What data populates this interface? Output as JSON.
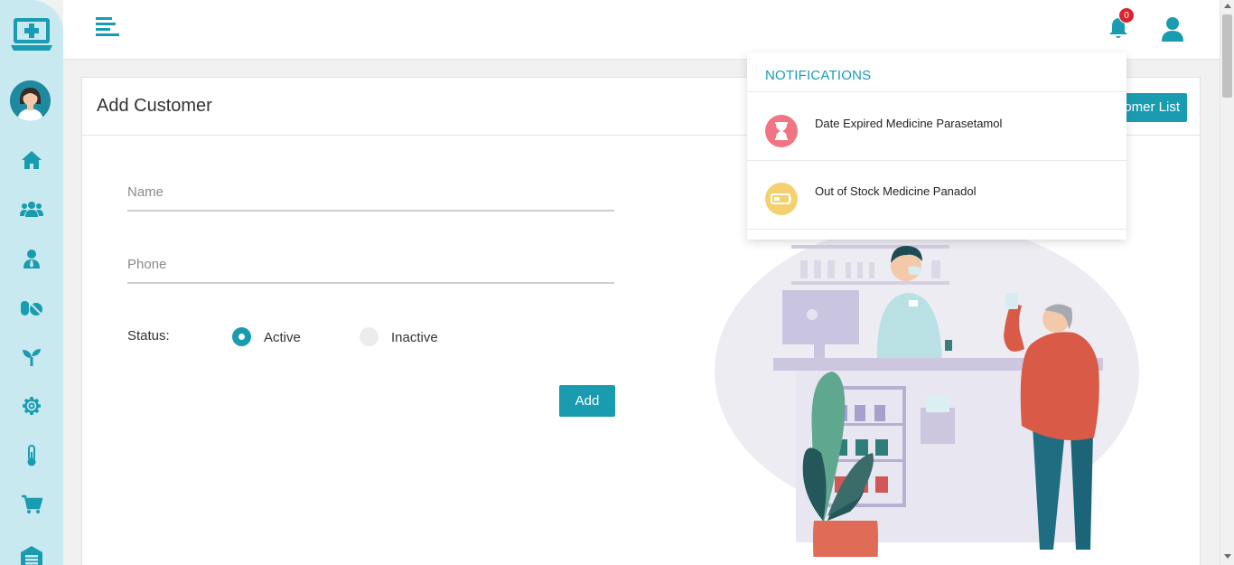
{
  "topbar": {
    "notification_count": "0"
  },
  "page": {
    "title": "Add Customer",
    "list_button_label": "omer List"
  },
  "form": {
    "name_placeholder": "Name",
    "phone_placeholder": "Phone",
    "status_label": "Status:",
    "status_options": [
      {
        "label": "Active",
        "selected": true
      },
      {
        "label": "Inactive",
        "selected": false
      }
    ],
    "submit_label": "Add"
  },
  "notifications": {
    "title": "NOTIFICATIONS",
    "items": [
      {
        "text": "Date Expired Medicine Parasetamol",
        "icon": "hourglass-icon",
        "color": "#f07482"
      },
      {
        "text": "Out of Stock Medicine Panadol",
        "icon": "battery-low-icon",
        "color": "#f4d06f"
      }
    ]
  },
  "sidebar": {
    "items": [
      {
        "icon": "home-icon"
      },
      {
        "icon": "users-icon"
      },
      {
        "icon": "user-tie-icon"
      },
      {
        "icon": "pills-icon"
      },
      {
        "icon": "seedling-icon"
      },
      {
        "icon": "gear-icon"
      },
      {
        "icon": "thermometer-icon"
      },
      {
        "icon": "cart-icon"
      },
      {
        "icon": "warehouse-icon"
      }
    ]
  },
  "colors": {
    "accent": "#1a9cb0",
    "sidebar_bg": "#c8e9f0",
    "badge": "#d9232e"
  }
}
